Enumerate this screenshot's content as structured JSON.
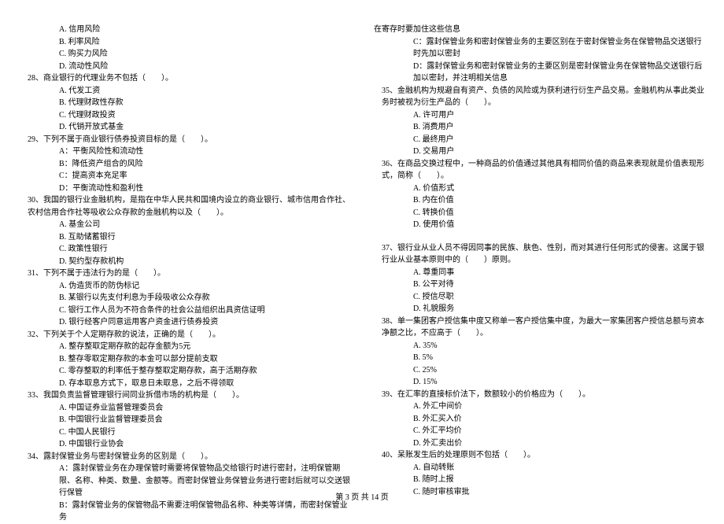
{
  "left": {
    "q27_opts": [
      "A. 信用风险",
      "B. 利率风险",
      "C. 购买力风险",
      "D. 流动性风险"
    ],
    "q28": "28、商业银行的代理业务不包括（　　）。",
    "q28_opts": [
      "A. 代发工资",
      "B. 代理财政性存款",
      "C. 代理财政投资",
      "D. 代销开放式基金"
    ],
    "q29": "29、下列不属于商业银行债券投资目标的是（　　）。",
    "q29_opts": [
      "A：平衡风险性和流动性",
      "B：降低资产组合的风险",
      "C：提高资本充足率",
      "D：平衡流动性和盈利性"
    ],
    "q30": "30、我国的银行业金融机构，是指在中华人民共和国境内设立的商业银行、城市信用合作社、农村信用合作社等吸收公众存款的金融机构以及（　　）。",
    "q30_opts": [
      "A. 基金公司",
      "B. 互助储蓄银行",
      "C. 政策性银行",
      "D. 契约型存款机构"
    ],
    "q31": "31、下列不属于违法行为的是（　　）。",
    "q31_opts": [
      "A. 伪造货币的防伪标记",
      "B. 某银行以先支付利息为手段吸收公众存款",
      "C. 银行工作人员为不符合条件的社会公益组织出具资信证明",
      "D. 银行经客户同意运用客户资金进行债券投资"
    ],
    "q32": "32、下列关于个人定期存款的说法，正确的是（　　）。",
    "q32_opts": [
      "A. 整存整取定期存款的起存金额为5元",
      "B. 整存零取定期存款的本金可以部分提前支取",
      "C. 零存整取的利率低于整存整取定期存款，高于活期存款",
      "D. 存本取息方式下，取息日未取息，之后不得领取"
    ],
    "q33": "33、我国负责监督管理银行间同业拆借市场的机构是（　　）。",
    "q33_opts": [
      "A. 中国证券业监督管理委员会",
      "B. 中国银行业监督管理委员会",
      "C. 中国人民银行",
      "D. 中国银行业协会"
    ],
    "q34": "34、露封保管业务与密封保管业务的区别是（　　）。",
    "q34_opts": [
      "A：露封保管业务在办理保管时需要将保管物品交给银行时进行密封，注明保管期限、名称、种类、数量、金额等。而密封保管业务保管业务进行密封后就可以交送银行保管",
      "B：露封保管业务的保管物品不需要注明保管物品名称、种类等详情，而密封保管业务"
    ]
  },
  "right": {
    "q34_cont": [
      "在寄存时要加住这些信息",
      "C：露封保管业务和密封保管业务的主要区别在于密封保管业务在保管物品交送银行时先加以密封",
      "D：露封保管业务和密封保管业务的主要区别是密封保管业务在保管物品交送银行后加以密封，并注明相关信息"
    ],
    "q35": "35、金融机构为规避自有资产、负债的风险或为获利进行衍生产品交易。金融机构从事此类业务时被视为衍生产品的（　　）。",
    "q35_opts": [
      "A. 许可用户",
      "B. 消费用户",
      "C. 最终用户",
      "D. 交易用户"
    ],
    "q36": "36、在商品交换过程中，一种商品的价值通过其他具有相同价值的商品来表现就是价值表现形式，简称（　　）。",
    "q36_opts": [
      "A. 价值形式",
      "B. 内在价值",
      "C. 转换价值",
      "D. 使用价值"
    ],
    "q37": "37、银行业从业人员不得因同事的民族、肤色、性别，而对其进行任何形式的侵害。这属于银行业从业基本原则中的（　　）原则。",
    "q37_opts": [
      "A. 尊重同事",
      "B. 公平对待",
      "C. 授信尽职",
      "D. 礼貌服务"
    ],
    "q38": "38、单一集团客户授信集中度又称单一客户授信集中度，为最大一家集团客户授信总额与资本净额之比，不应高于（　　）。",
    "q38_opts": [
      "A. 35%",
      "B. 5%",
      "C. 25%",
      "D. 15%"
    ],
    "q39": "39、在汇率的直接标价法下，数额较小的价格应为（　　）。",
    "q39_opts": [
      "A. 外汇中间价",
      "B. 外汇买入价",
      "C. 外汇平均价",
      "D. 外汇卖出价"
    ],
    "q40": "40、呆账发生后的处理原则不包括（　　）。",
    "q40_opts": [
      "A. 自动转账",
      "B. 随时上报",
      "C. 随时审核审批"
    ]
  },
  "footer": "第 3 页 共 14 页"
}
